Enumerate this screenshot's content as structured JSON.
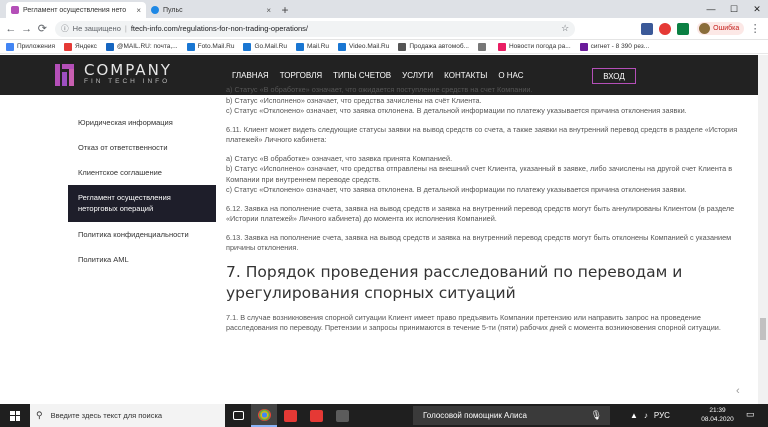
{
  "browser": {
    "tabs": [
      {
        "title": "Регламент осуществления нето",
        "active": true,
        "close": "×"
      },
      {
        "title": "Пульс",
        "active": false,
        "close": "×"
      }
    ],
    "new_tab": "+",
    "window_controls": {
      "minimize": "—",
      "maximize": "☐",
      "close": "✕"
    },
    "nav": {
      "back": "←",
      "forward": "→",
      "reload": "⟳"
    },
    "address": {
      "security_text": "Не защищено",
      "separator": "|",
      "url": "ftech-info.com/regulations-for-non-trading-operations/",
      "star": "☆"
    },
    "profile": {
      "label": "Ошибка"
    },
    "menu": "⋮",
    "bookmarks": [
      {
        "label": "Приложения",
        "color": "#4285f4"
      },
      {
        "label": "Яндекс",
        "color": "#e53935"
      },
      {
        "label": "@MAIL.RU: почта,...",
        "color": "#1565c0"
      },
      {
        "label": "Foto.Mail.Ru",
        "color": "#1976d2"
      },
      {
        "label": "Go.Mail.Ru",
        "color": "#1976d2"
      },
      {
        "label": "Mail.Ru",
        "color": "#1976d2"
      },
      {
        "label": "Video.Mail.Ru",
        "color": "#1976d2"
      },
      {
        "label": "Продажа автомоб...",
        "color": "#555555"
      },
      {
        "label": "",
        "color": "#777777"
      },
      {
        "label": "Новости погода ра...",
        "color": "#e91e63"
      },
      {
        "label": "сигнет - 8 390 рез...",
        "color": "#6a1b9a"
      }
    ]
  },
  "site": {
    "logo": {
      "name": "COMPANY",
      "sub": "FIN TECH INFO"
    },
    "nav": [
      "Главная",
      "Торговля",
      "Типы счетов",
      "Услуги",
      "Контакты",
      "О нас"
    ],
    "login": "ВХОД",
    "sidebar": [
      {
        "label": "Юридическая информация",
        "active": false
      },
      {
        "label": "Отказ от ответственности",
        "active": false
      },
      {
        "label": "Клиентское соглашение",
        "active": false
      },
      {
        "label": "Регламент осуществления неторговых операций",
        "active": true
      },
      {
        "label": "Политика конфиденциальности",
        "active": false
      },
      {
        "label": "Политика AML",
        "active": false
      }
    ],
    "content": {
      "p1": "а) Статус «В обработке» означает, что ожидается поступление средств на счет Компании.\nb) Статус «Исполнено» означает, что средства зачислены на счёт Клиента.\nc) Статус «Отклонено» означает, что заявка отклонена. В детальной информации по платежу указывается причина отклонения заявки.",
      "p2": "6.11. Клиент может видеть следующие статусы заявки на вывод средств со счета, а также заявки на внутренний перевод средств в разделе «История платежей» Личного кабинета:",
      "p3": "а) Статус «В обработке» означает, что заявка принята Компанией.\nb) Статус «Исполнено» означает, что средства отправлены на внешний счет Клиента, указанный в заявке, либо зачислены на другой счет Клиента в Компании при внутреннем переводе средств.\nc) Статус «Отклонено» означает, что заявка отклонена. В детальной информации по платежу указывается причина отклонения заявки.",
      "p4": "6.12. Заявка на пополнение счета, заявка на вывод средств и заявка на внутренний перевод средств могут быть аннулированы Клиентом (в разделе «Истории платежей» Личного кабинета) до момента их исполнения Компанией.",
      "p5": "6.13. Заявка на пополнение счета, заявка на вывод средств и заявка на внутренний перевод средств могут быть отклонены Компанией с указанием причины отклонения.",
      "heading": "7. Порядок проведения расследований по переводам и урегулирования спорных ситуаций",
      "p6": "7.1. В случае возникновения спорной ситуации Клиент имеет право предъявить Компании претензию или направить запрос на проведение расследования по переводу. Претензии и запросы принимаются в течение 5-ти (пяти) рабочих дней с момента возникновения спорной ситуации."
    }
  },
  "taskbar": {
    "search_placeholder": "Введите здесь текст для поиска",
    "search_icon": "search-icon",
    "cortana": "Голосовой помощник Алиса",
    "lang": "РУС",
    "time": "21:39",
    "date": "08.04.2020"
  }
}
